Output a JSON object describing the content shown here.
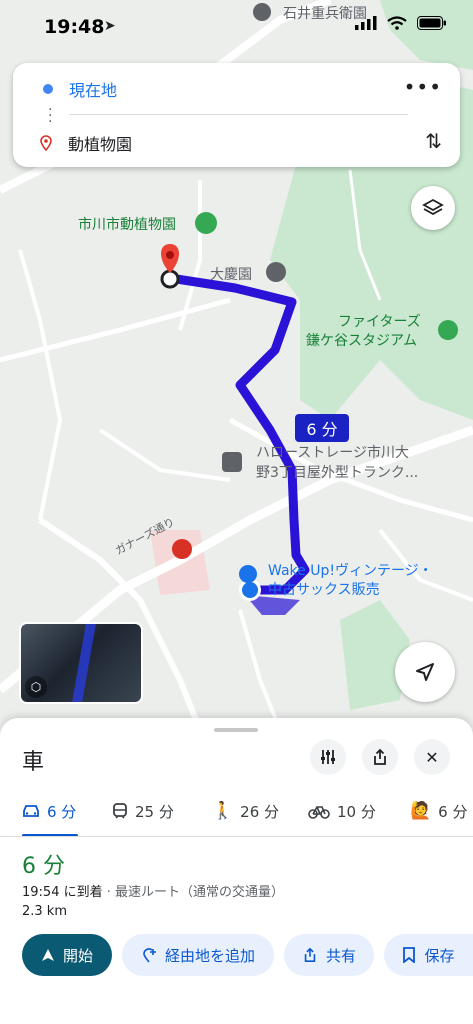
{
  "status_bar": {
    "time": "19:48"
  },
  "route_card": {
    "origin": "現在地",
    "destination": "動植物園",
    "more_icon": "more-horizontal-icon",
    "swap_icon": "swap-vertical-icon"
  },
  "map": {
    "labels": {
      "top_place": "石井重兵衛園",
      "zoo": "市川市動植物園",
      "daikeien": "大慶園",
      "stadium_line1": "ファイターズ",
      "stadium_line2": "鎌ケ谷スタジアム",
      "storage_line1": "ハローストレージ市川大",
      "storage_line2": "野3丁目屋外型トランク...",
      "road": "ガナーズ通り",
      "shop_line1": "Wake Up!ヴィンテージ・",
      "shop_line2": "中古サックス販売"
    },
    "route_time": "6 分",
    "colors": {
      "route": "#2a13d6",
      "park": "#c9e8cf",
      "road": "#ffffff"
    }
  },
  "sheet": {
    "title": "車",
    "modes": [
      {
        "icon": "car-icon",
        "label": "6 分"
      },
      {
        "icon": "train-icon",
        "label": "25 分"
      },
      {
        "icon": "walk-icon",
        "label": "26 分"
      },
      {
        "icon": "bike-icon",
        "label": "10 分"
      },
      {
        "icon": "ride-hail-icon",
        "label": "6 分"
      }
    ],
    "duration": "6 分",
    "arrive_time": "19:54 に到着",
    "arrive_sub": "· 最速ルート（通常の交通量）",
    "distance": "2.3 km",
    "actions": {
      "start": "開始",
      "add_stop": "経由地を追加",
      "share": "共有",
      "save": "保存"
    }
  }
}
